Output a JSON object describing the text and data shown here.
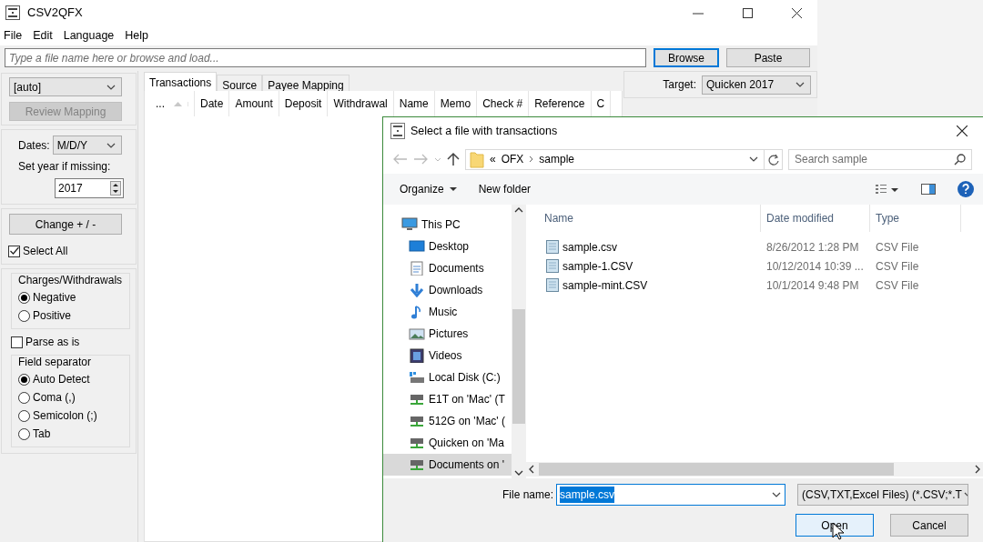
{
  "window": {
    "title": "CSV2QFX"
  },
  "menu": [
    "File",
    "Edit",
    "Language",
    "Help"
  ],
  "file_field": {
    "placeholder": "Type a file name here or browse and load..."
  },
  "top_buttons": [
    {
      "label": "Browse",
      "focused": true
    },
    {
      "label": "Paste",
      "focused": false
    }
  ],
  "left_panel": {
    "mapping_select": "[auto]",
    "review_button": {
      "label": "Review Mapping",
      "disabled": true
    },
    "dates_label": "Dates:",
    "dates_select": "M/D/Y",
    "year_label": "Set year if missing:",
    "year_value": "2017",
    "change_button": "Change + / -",
    "select_all": {
      "label": "Select All",
      "checked": true
    },
    "charges": {
      "title": "Charges/Withdrawals",
      "options": [
        {
          "label": "Negative",
          "selected": true
        },
        {
          "label": "Positive",
          "selected": false
        }
      ]
    },
    "parse_as_is": {
      "label": "Parse as is",
      "checked": false
    },
    "separator": {
      "title": "Field separator",
      "options": [
        {
          "label": "Auto Detect",
          "selected": true
        },
        {
          "label": "Coma (,)",
          "selected": false
        },
        {
          "label": "Semicolon (;)",
          "selected": false
        },
        {
          "label": "Tab",
          "selected": false
        }
      ]
    }
  },
  "tabs": [
    {
      "label": "Transactions",
      "selected": true
    },
    {
      "label": "Source",
      "selected": false
    },
    {
      "label": "Payee Mapping",
      "selected": false
    }
  ],
  "table": {
    "columns": [
      "...",
      "Date",
      "Amount",
      "Deposit",
      "Withdrawal",
      "Name",
      "Memo",
      "Check #",
      "Reference",
      "C"
    ]
  },
  "right_panel": {
    "target_label": "Target:",
    "target_value": "Quicken 2017"
  },
  "dialog": {
    "title": "Select a file with transactions",
    "address": {
      "overflow": "«",
      "crumbs": [
        "OFX",
        "sample"
      ]
    },
    "search": {
      "placeholder": "Search sample"
    },
    "toolbar": {
      "organize": "Organize",
      "new_folder": "New folder"
    },
    "nav": [
      {
        "label": "This PC",
        "kind": "pc",
        "selected": false,
        "children": [
          {
            "label": "Desktop",
            "kind": "desktop",
            "selected": false
          },
          {
            "label": "Documents",
            "kind": "documents",
            "selected": false
          },
          {
            "label": "Downloads",
            "kind": "downloads",
            "selected": false
          },
          {
            "label": "Music",
            "kind": "music",
            "selected": false
          },
          {
            "label": "Pictures",
            "kind": "pictures",
            "selected": false
          },
          {
            "label": "Videos",
            "kind": "videos",
            "selected": false
          },
          {
            "label": "Local Disk (C:)",
            "kind": "disk",
            "selected": false
          },
          {
            "label": "E1T on 'Mac' (T",
            "kind": "network",
            "selected": false
          },
          {
            "label": "512G on 'Mac' (",
            "kind": "network",
            "selected": false
          },
          {
            "label": "Quicken on 'Ma",
            "kind": "network",
            "selected": false
          },
          {
            "label": "Documents on '",
            "kind": "network",
            "selected": true
          }
        ]
      }
    ],
    "columns": [
      "Name",
      "Date modified",
      "Type"
    ],
    "files": [
      {
        "name": "sample.csv",
        "date": "8/26/2012 1:28 PM",
        "type": "CSV File"
      },
      {
        "name": "sample-1.CSV",
        "date": "10/12/2014 10:39 ...",
        "type": "CSV File"
      },
      {
        "name": "sample-mint.CSV",
        "date": "10/1/2014 9:48 PM",
        "type": "CSV File"
      }
    ],
    "file_name_label": "File name:",
    "file_name": {
      "value": "sample.csv",
      "text_selected": true
    },
    "filter": "(CSV,TXT,Excel Files) (*.CSV;*.T",
    "buttons": [
      {
        "label": "Open",
        "focused": true
      },
      {
        "label": "Cancel",
        "focused": false
      }
    ]
  }
}
